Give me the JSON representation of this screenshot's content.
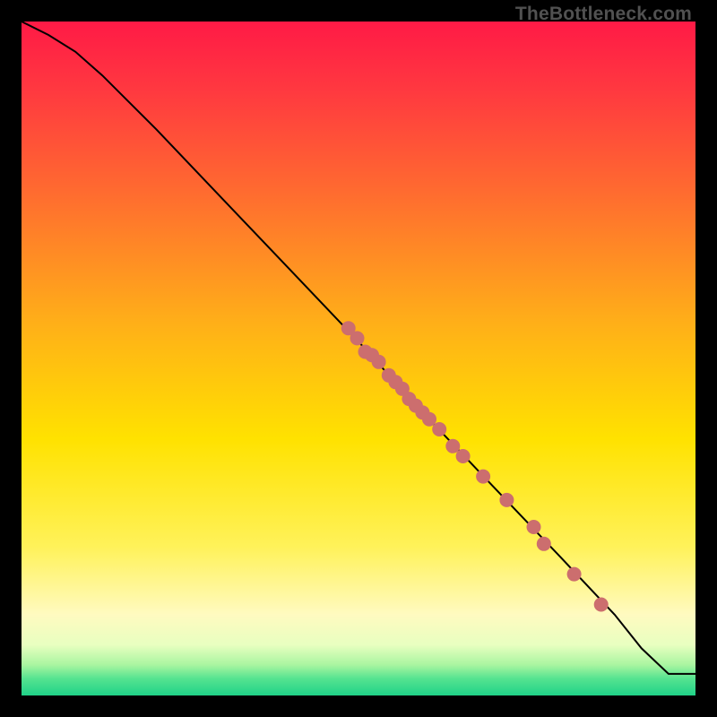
{
  "watermark": "TheBottleneck.com",
  "colors": {
    "point": "#cc6e6e",
    "curve": "#000000",
    "frame_bg": "#000000"
  },
  "gradient_stops": [
    {
      "offset": 0.0,
      "color": "#ff1a46"
    },
    {
      "offset": 0.1,
      "color": "#ff3840"
    },
    {
      "offset": 0.25,
      "color": "#ff6a30"
    },
    {
      "offset": 0.45,
      "color": "#ffb018"
    },
    {
      "offset": 0.62,
      "color": "#ffe200"
    },
    {
      "offset": 0.78,
      "color": "#fff25a"
    },
    {
      "offset": 0.88,
      "color": "#fffac0"
    },
    {
      "offset": 0.925,
      "color": "#e8ffc0"
    },
    {
      "offset": 0.955,
      "color": "#a8f5a0"
    },
    {
      "offset": 0.975,
      "color": "#55e390"
    },
    {
      "offset": 1.0,
      "color": "#20d288"
    }
  ],
  "chart_data": {
    "type": "line",
    "title": "",
    "xlabel": "",
    "ylabel": "",
    "xlim": [
      0,
      100
    ],
    "ylim": [
      0,
      100
    ],
    "series": [
      {
        "name": "curve",
        "x": [
          0,
          4,
          8,
          12,
          20,
          30,
          40,
          50,
          60,
          70,
          80,
          88,
          92,
          96,
          100
        ],
        "y": [
          100,
          98,
          95.5,
          92,
          84,
          73.5,
          63,
          52.5,
          41.5,
          31,
          20.5,
          12,
          7,
          3.2,
          3.2
        ]
      }
    ],
    "scatter": [
      {
        "x": 48.5,
        "y": 54.5
      },
      {
        "x": 49.8,
        "y": 53.0
      },
      {
        "x": 51.0,
        "y": 51.0
      },
      {
        "x": 52.0,
        "y": 50.5
      },
      {
        "x": 53.0,
        "y": 49.5
      },
      {
        "x": 54.5,
        "y": 47.5
      },
      {
        "x": 55.5,
        "y": 46.5
      },
      {
        "x": 56.5,
        "y": 45.5
      },
      {
        "x": 57.5,
        "y": 44.0
      },
      {
        "x": 58.5,
        "y": 43.0
      },
      {
        "x": 59.5,
        "y": 42.0
      },
      {
        "x": 60.5,
        "y": 41.0
      },
      {
        "x": 62.0,
        "y": 39.5
      },
      {
        "x": 64.0,
        "y": 37.0
      },
      {
        "x": 65.5,
        "y": 35.5
      },
      {
        "x": 68.5,
        "y": 32.5
      },
      {
        "x": 72.0,
        "y": 29.0
      },
      {
        "x": 76.0,
        "y": 25.0
      },
      {
        "x": 77.5,
        "y": 22.5
      },
      {
        "x": 82.0,
        "y": 18.0
      },
      {
        "x": 86.0,
        "y": 13.5
      }
    ]
  }
}
